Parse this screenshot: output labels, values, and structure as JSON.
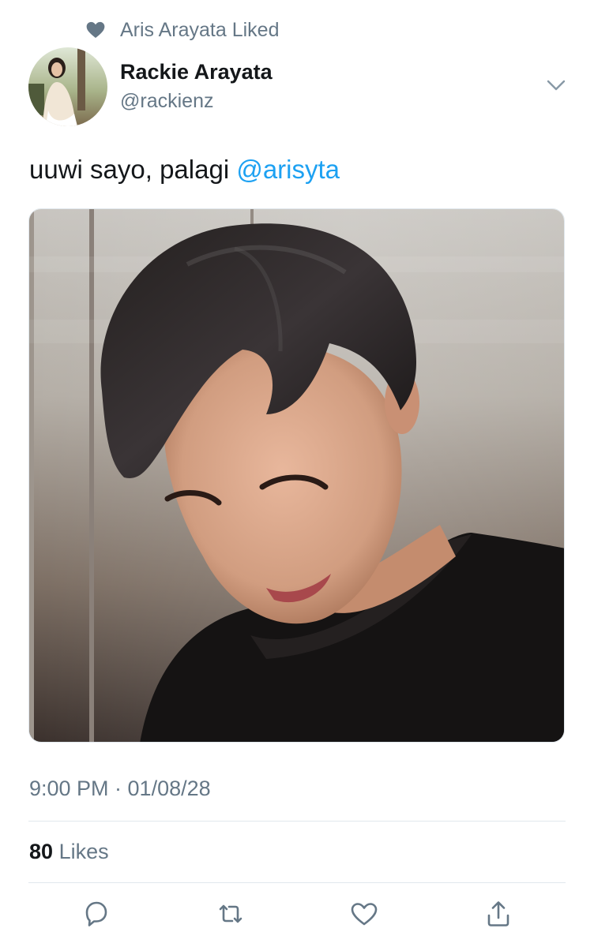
{
  "social_context": {
    "icon": "heart-icon",
    "text": "Aris Arayata Liked"
  },
  "author": {
    "name": "Rackie Arayata",
    "handle": "@rackienz"
  },
  "tweet": {
    "text": "uuwi sayo, palagi",
    "mention": "@arisyta",
    "timestamp": "9:00 PM · 01/08/28"
  },
  "stats": {
    "likes_count": "80",
    "likes_label": "Likes"
  },
  "actions": [
    {
      "name": "reply",
      "icon": "reply-icon"
    },
    {
      "name": "retweet",
      "icon": "retweet-icon"
    },
    {
      "name": "like",
      "icon": "heart-outline-icon"
    },
    {
      "name": "share",
      "icon": "share-icon"
    }
  ],
  "colors": {
    "text_primary": "#14171a",
    "text_secondary": "#657786",
    "link": "#1da1f2",
    "divider": "#e1e8ed"
  }
}
